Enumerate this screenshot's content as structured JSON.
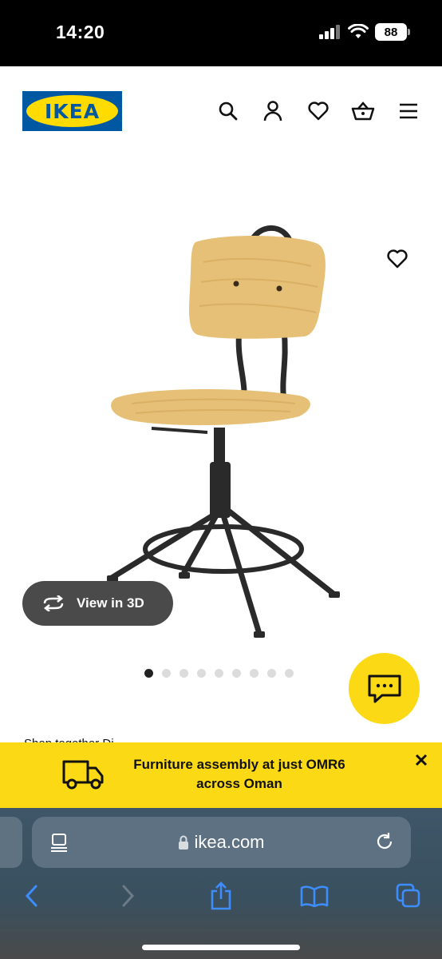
{
  "status_bar": {
    "time": "14:20",
    "battery": "88"
  },
  "header": {
    "logo_text": "IKEA",
    "icons": [
      "search-icon",
      "account-icon",
      "heart-icon",
      "cart-icon",
      "menu-icon"
    ]
  },
  "product": {
    "view_3d_label": "View in 3D",
    "carousel": {
      "total": 9,
      "active": 1
    }
  },
  "peek_text": "Shop together   Di...",
  "banner": {
    "line1": "Furniture assembly at just OMR6",
    "line2": "across Oman"
  },
  "browser": {
    "url": "ikea.com"
  },
  "colors": {
    "ikea_blue": "#0058a3",
    "ikea_yellow": "#fbd914",
    "dark": "#111111"
  }
}
